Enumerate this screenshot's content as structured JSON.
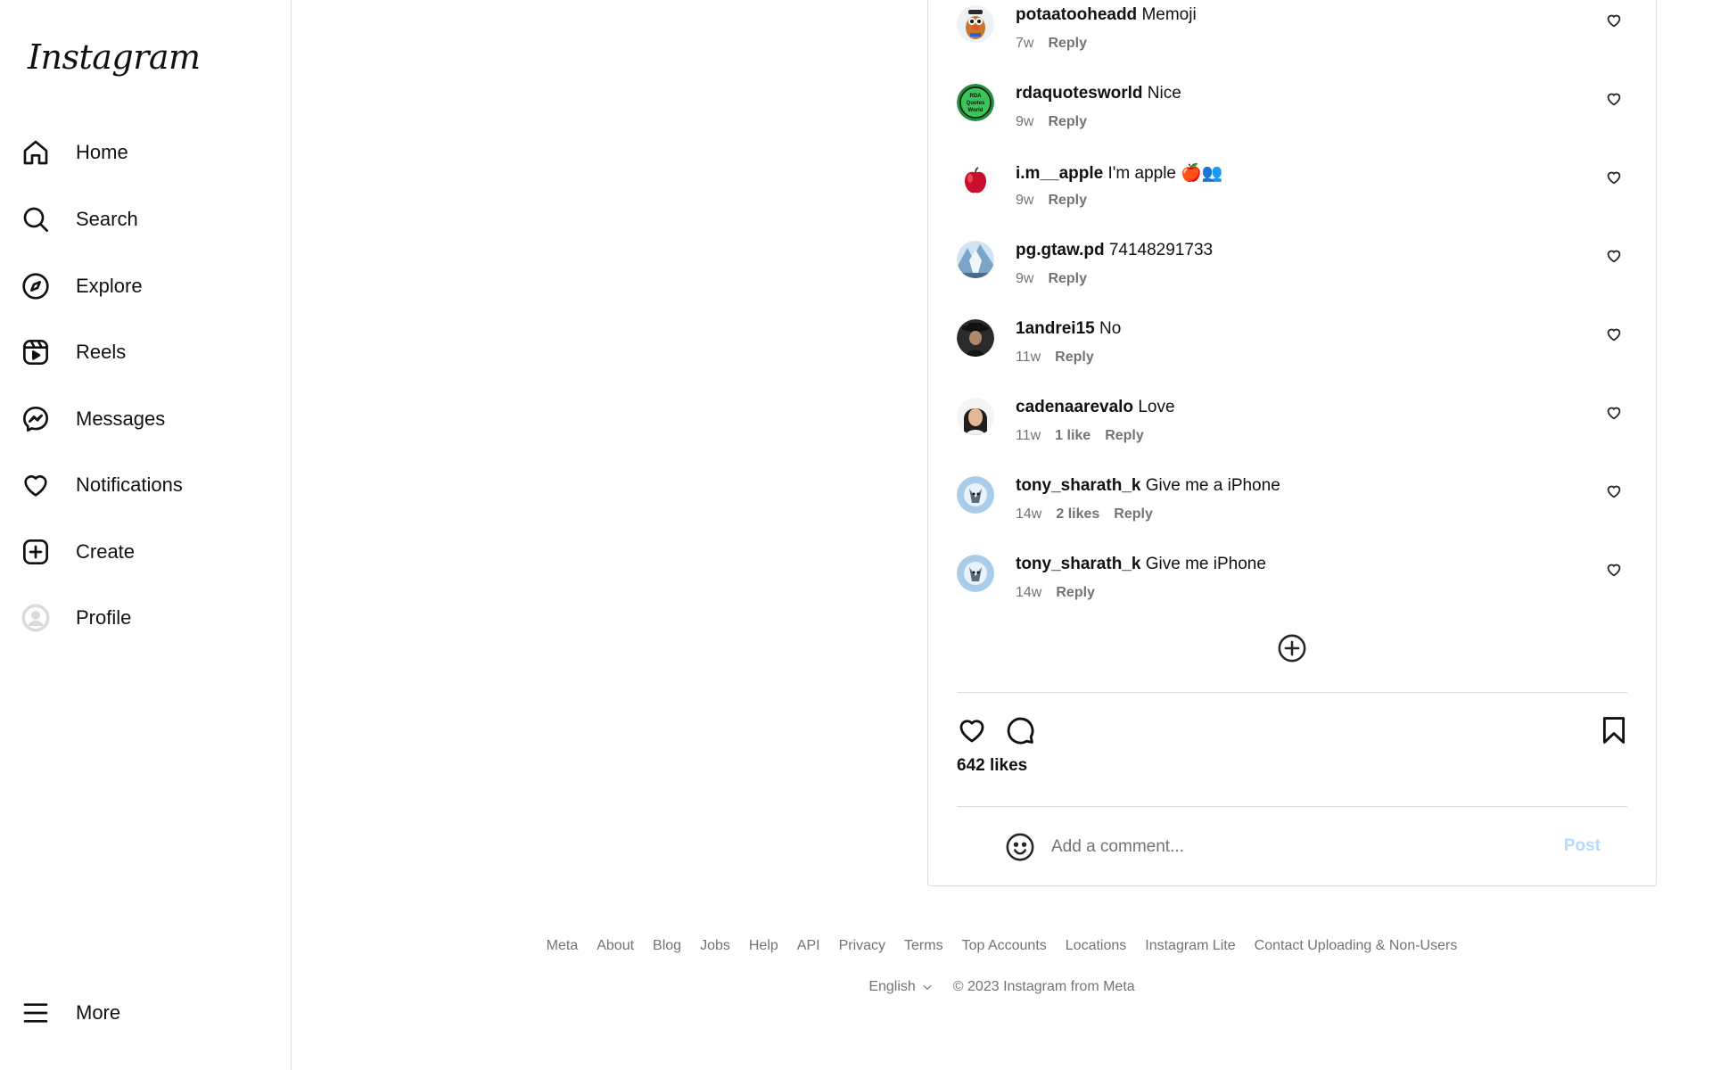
{
  "app": {
    "logo_text": "Instagram"
  },
  "sidebar": {
    "items": [
      {
        "label": "Home",
        "icon": "home-icon"
      },
      {
        "label": "Search",
        "icon": "search-icon"
      },
      {
        "label": "Explore",
        "icon": "compass-icon"
      },
      {
        "label": "Reels",
        "icon": "reels-icon"
      },
      {
        "label": "Messages",
        "icon": "messenger-icon"
      },
      {
        "label": "Notifications",
        "icon": "heart-icon"
      },
      {
        "label": "Create",
        "icon": "plus-square-icon"
      },
      {
        "label": "Profile",
        "icon": "avatar"
      }
    ],
    "more_label": "More"
  },
  "comments": [
    {
      "user": "potaatooheadd",
      "text": "Memoji",
      "age": "7w",
      "likes": "",
      "reply": "Reply"
    },
    {
      "user": "rdaquotesworld",
      "text": "Nice",
      "age": "9w",
      "likes": "",
      "reply": "Reply"
    },
    {
      "user": "i.m__apple",
      "text": "I'm apple 🍎👥",
      "age": "9w",
      "likes": "",
      "reply": "Reply"
    },
    {
      "user": "pg.gtaw.pd",
      "text": "74148291733",
      "age": "9w",
      "likes": "",
      "reply": "Reply"
    },
    {
      "user": "1andrei15",
      "text": "No",
      "age": "11w",
      "likes": "",
      "reply": "Reply"
    },
    {
      "user": "cadenaarevalo",
      "text": "Love",
      "age": "11w",
      "likes": "1 like",
      "reply": "Reply"
    },
    {
      "user": "tony_sharath_k",
      "text": "Give me a iPhone",
      "age": "14w",
      "likes": "2 likes",
      "reply": "Reply"
    },
    {
      "user": "tony_sharath_k",
      "text": "Give me iPhone",
      "age": "14w",
      "likes": "",
      "reply": "Reply"
    }
  ],
  "post": {
    "likes_count": "642 likes",
    "comment_placeholder": "Add a comment...",
    "post_label": "Post"
  },
  "footer": {
    "links": [
      "Meta",
      "About",
      "Blog",
      "Jobs",
      "Help",
      "API",
      "Privacy",
      "Terms",
      "Top Accounts",
      "Locations",
      "Instagram Lite",
      "Contact Uploading & Non-Users"
    ],
    "language": "English",
    "copyright": "© 2023 Instagram from Meta"
  },
  "colors": {
    "post_button": "#b3dbff",
    "muted_text": "#737373",
    "border": "#dbdbdb"
  }
}
